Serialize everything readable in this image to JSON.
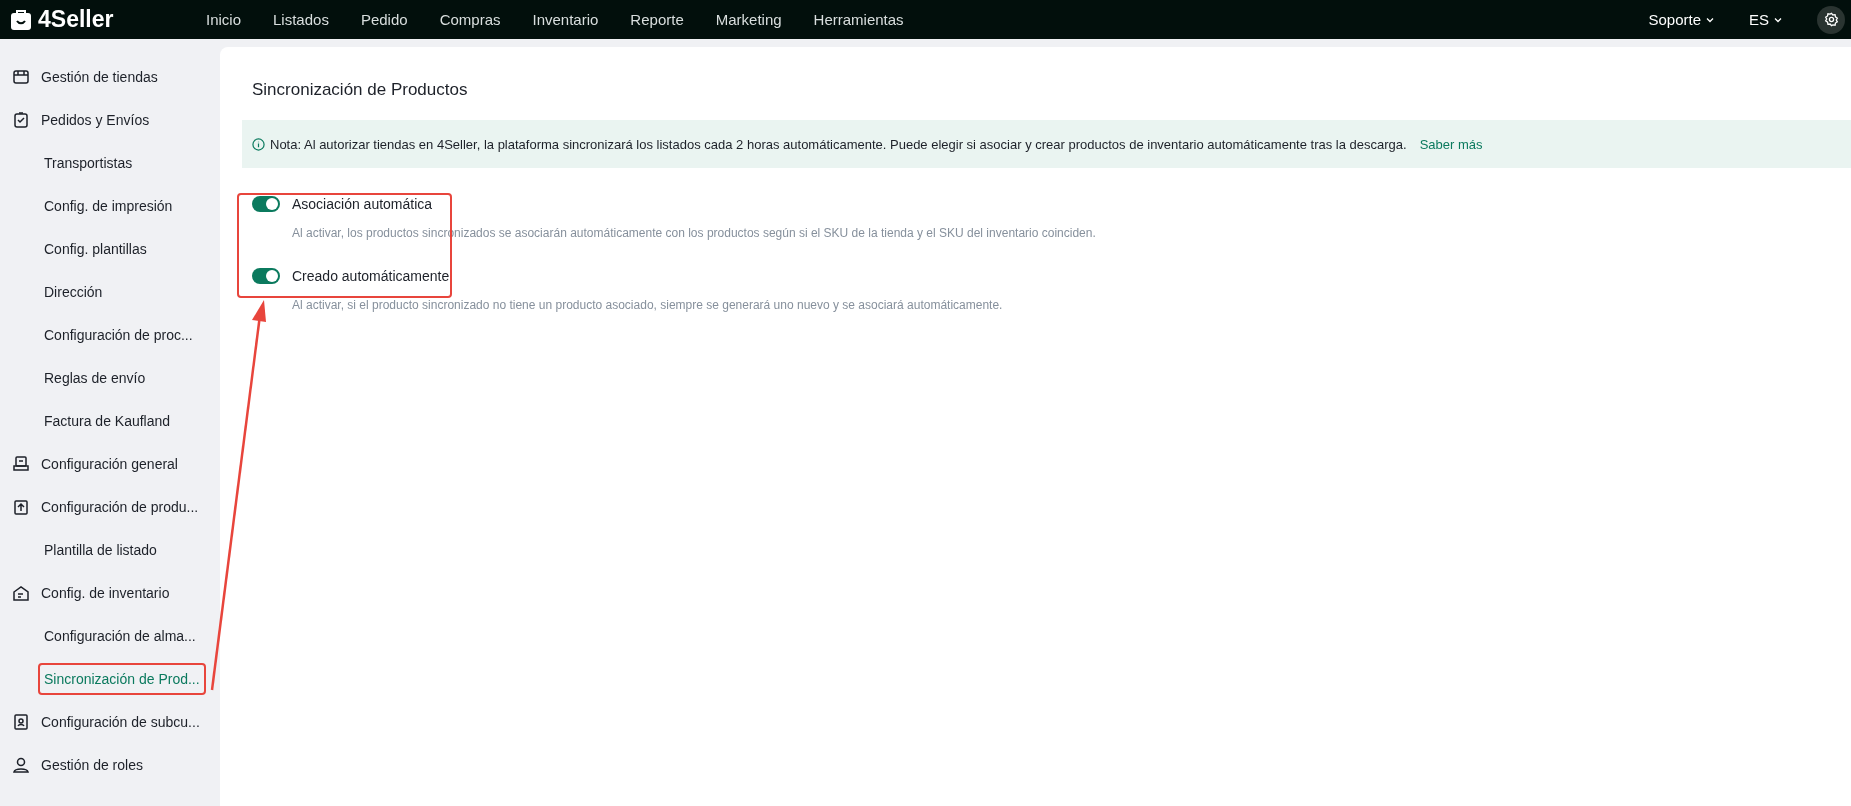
{
  "topbar": {
    "logo": "4Seller",
    "nav": [
      {
        "label": "Inicio"
      },
      {
        "label": "Listados"
      },
      {
        "label": "Pedido"
      },
      {
        "label": "Compras"
      },
      {
        "label": "Inventario"
      },
      {
        "label": "Reporte"
      },
      {
        "label": "Marketing"
      },
      {
        "label": "Herramientas"
      }
    ],
    "menus": [
      {
        "label": "Soporte"
      },
      {
        "label": "ES"
      }
    ]
  },
  "sidebar": {
    "items": [
      {
        "label": "Gestión de tiendas",
        "kind": "group",
        "selected": false,
        "marked": false
      },
      {
        "label": "Pedidos y Envíos",
        "kind": "group",
        "selected": false,
        "marked": false
      },
      {
        "label": "Transportistas",
        "kind": "sub",
        "selected": false,
        "marked": false
      },
      {
        "label": "Config. de impresión",
        "kind": "sub",
        "selected": false,
        "marked": false
      },
      {
        "label": "Config. plantillas",
        "kind": "sub",
        "selected": false,
        "marked": false
      },
      {
        "label": "Dirección",
        "kind": "sub",
        "selected": false,
        "marked": false
      },
      {
        "label": "Configuración de proc...",
        "kind": "sub",
        "selected": false,
        "marked": false
      },
      {
        "label": "Reglas de envío",
        "kind": "sub",
        "selected": false,
        "marked": false
      },
      {
        "label": "Factura de Kaufland",
        "kind": "sub",
        "selected": false,
        "marked": false
      },
      {
        "label": "Configuración general",
        "kind": "group",
        "selected": false,
        "marked": false
      },
      {
        "label": "Configuración de produ...",
        "kind": "group",
        "selected": false,
        "marked": false
      },
      {
        "label": "Plantilla de listado",
        "kind": "sub",
        "selected": false,
        "marked": false
      },
      {
        "label": "Config. de inventario",
        "kind": "group",
        "selected": false,
        "marked": false
      },
      {
        "label": "Configuración de alma...",
        "kind": "sub",
        "selected": false,
        "marked": false
      },
      {
        "label": "Sincronización de Prod...",
        "kind": "sub",
        "selected": true,
        "marked": true
      },
      {
        "label": "Configuración de subcu...",
        "kind": "group",
        "selected": false,
        "marked": false
      },
      {
        "label": "Gestión de roles",
        "kind": "group",
        "selected": false,
        "marked": false
      }
    ]
  },
  "page": {
    "title": "Sincronización de Productos",
    "note": {
      "text": "Nota: Al autorizar tiendas en 4Seller, la plataforma sincronizará los listados cada 2 horas automáticamente. Puede elegir si asociar y crear productos de inventario automáticamente tras la descarga.",
      "link": "Saber más"
    },
    "settings_marked": true,
    "settings": [
      {
        "label": "Asociación automática",
        "on": true,
        "description": "Al activar, los productos sincronizados se asociarán automáticamente con los productos según si el SKU de la tienda y el SKU del inventario coinciden."
      },
      {
        "label": "Creado automáticamente",
        "on": true,
        "description": "Al activar, si el producto sincronizado no tiene un producto asociado, siempre se generará uno nuevo y se asociará automáticamente."
      }
    ]
  }
}
